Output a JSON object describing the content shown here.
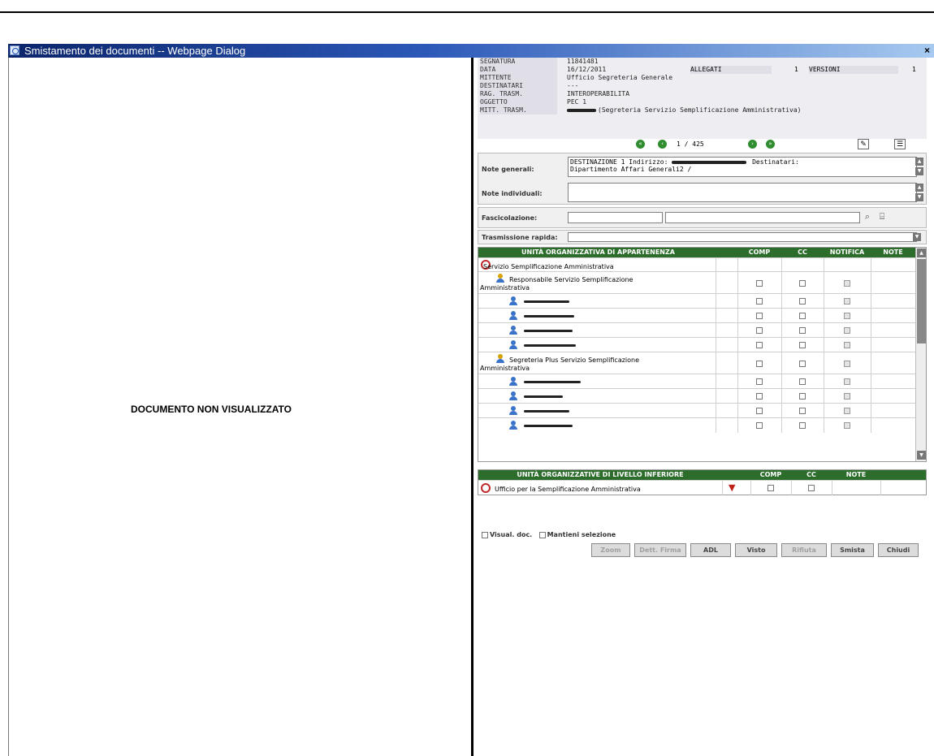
{
  "window": {
    "title": "Smistamento dei documenti -- Webpage Dialog",
    "close_glyph": "×"
  },
  "left": {
    "message": "DOCUMENTO NON VISUALIZZATO"
  },
  "info": {
    "segnatura_label": "SEGNATURA",
    "segnatura": "11841481",
    "data_label": "DATA",
    "data": "16/12/2011",
    "allegati_label": "ALLEGATI",
    "allegati": "1",
    "versioni_label": "VERSIONI",
    "versioni": "1",
    "mittente_label": "MITTENTE",
    "mittente": "Ufficio Segreteria Generale",
    "destinatari_label": "DESTINATARI",
    "destinatari": "---",
    "rag_label": "RAG. TRASM.",
    "rag": "INTEROPERABILITA",
    "oggetto_label": "OGGETTO",
    "oggetto": "PEC 1",
    "mitt_trasm_label": "MITT. TRASM.",
    "mitt_trasm": "(Segreteria Servizio Semplificazione Amministrativa)"
  },
  "nav": {
    "first": "«",
    "prev": "‹",
    "page": "1 / 425",
    "next": "›",
    "last": "»"
  },
  "notes": {
    "generali_label": "Note generali:",
    "generali_text": "DESTINAZIONE 1 Indirizzo:",
    "generali_text2": "Destinatari:",
    "generali_text3": "Dipartimento Affari Generali2 /",
    "individuali_label": "Note individuali:"
  },
  "fascicolazione_label": "Fascicolazione:",
  "trasmissione_label": "Trasmissione rapida:",
  "grid": {
    "headers": {
      "unit": "UNITÀ ORGANIZZATIVA DI APPARTENENZA",
      "comp": "COMP",
      "cc": "CC",
      "notifica": "NOTIFICA",
      "note": "NOTE"
    },
    "rows": [
      {
        "kind": "office",
        "label": "Servizio Semplificazione Amministrativa"
      },
      {
        "kind": "group",
        "label": "Responsabile Servizio Semplificazione",
        "label2": "Amministrativa"
      },
      {
        "kind": "person"
      },
      {
        "kind": "person"
      },
      {
        "kind": "person"
      },
      {
        "kind": "person"
      },
      {
        "kind": "group",
        "label": "Segreteria Plus Servizio Semplificazione",
        "label2": "Amministrativa"
      },
      {
        "kind": "person"
      },
      {
        "kind": "person"
      },
      {
        "kind": "person"
      },
      {
        "kind": "person"
      }
    ]
  },
  "grid2": {
    "headers": {
      "unit": "UNITÀ ORGANIZZATIVE DI LIVELLO INFERIORE",
      "comp": "COMP",
      "cc": "CC",
      "note": "NOTE"
    },
    "row": "Ufficio per la Semplificazione Amministrativa"
  },
  "options": {
    "visual_doc": "Visual. doc.",
    "mantieni": "Mantieni selezione"
  },
  "buttons": {
    "zoom": "Zoom",
    "dett_firma": "Dett. Firma",
    "adl": "ADL",
    "visto": "Visto",
    "rifiuta": "Rifiuta",
    "smista": "Smista",
    "chiudi": "Chiudi"
  },
  "colors": {
    "title_bar": "#0a246a",
    "grid_header": "#2c6d2c",
    "nav_button": "#2f8d2f"
  }
}
